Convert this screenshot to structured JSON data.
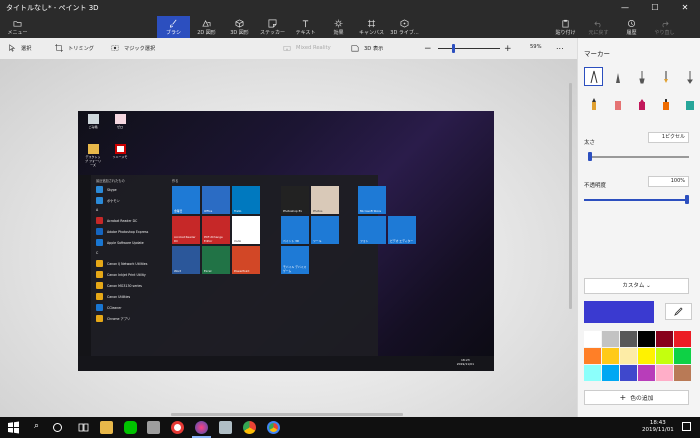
{
  "window": {
    "title": "タイトルなし* - ペイント 3D",
    "minimize": "—",
    "maximize": "☐",
    "close": "✕"
  },
  "toolbar": {
    "menu_label": "メニュー",
    "tools": [
      {
        "label": "ブラシ",
        "icon": "brush-icon",
        "active": true
      },
      {
        "label": "2D 図形",
        "icon": "2d-shapes-icon"
      },
      {
        "label": "3D 図形",
        "icon": "3d-shapes-icon"
      },
      {
        "label": "ステッカー",
        "icon": "stickers-icon"
      },
      {
        "label": "テキスト",
        "icon": "text-icon"
      },
      {
        "label": "効果",
        "icon": "effects-icon"
      },
      {
        "label": "キャンバス",
        "icon": "canvas-icon"
      },
      {
        "label": "3D ライブ...",
        "icon": "3d-library-icon"
      }
    ],
    "right_tools": [
      {
        "label": "貼り付け",
        "icon": "paste-icon"
      },
      {
        "label": "元に戻す",
        "icon": "undo-icon"
      },
      {
        "label": "履歴",
        "icon": "history-icon"
      },
      {
        "label": "やり直し",
        "icon": "redo-icon"
      }
    ]
  },
  "subbar": {
    "select": "選択",
    "crop": "トリミング",
    "magic_select": "マジック選択",
    "mixed_reality": "Mixed Reality",
    "view3d": "3D 表示",
    "zoom": "59%",
    "more": "..."
  },
  "screenshot": {
    "desktop_icons": [
      "ごみ箱",
      "ゼロ",
      "デスクトップ フォーリーズ",
      "ソニーメモ"
    ],
    "start_header": "最近追加されたもの",
    "start_apps": [
      "Skype",
      "ポケモン",
      "A",
      "Acrobat Reader DC",
      "Adobe Photoshop Express",
      "Apple Software Update",
      "C",
      "Canon IJ Network Utilities",
      "Canon Inkjet Print Utility",
      "Canon MG3130 series",
      "Canon Utilities",
      "CCleaner",
      "Chrome アプリ"
    ],
    "tiles_header": "作る",
    "tiles": [
      "金曜日",
      "Office",
      "Trello",
      "Acrobat Reader DC",
      "PDF-XChange Editor",
      "Xodo",
      "Word",
      "Excel",
      "PowerPoint",
      "Photoshop Ex",
      "Photos",
      "ペイント 3D",
      "ツール",
      "Microsoft Store",
      "フォト",
      "ビデオ エディター",
      "モバイル デバイス ゲーム"
    ],
    "clock": "18:23\n2019/11/01"
  },
  "panel": {
    "title": "マーカー",
    "thickness_label": "太さ",
    "thickness_value": "1ピクセル",
    "opacity_label": "不透明度",
    "opacity_value": "100%",
    "color_mode": "カスタム",
    "add_color": "色の追加",
    "main_color": "#3a3ad0",
    "palette": [
      "#ffffff",
      "#c3c3c3",
      "#585858",
      "#000000",
      "#88001b",
      "#ec1c24",
      "#ff7f27",
      "#ffca18",
      "#fdeca6",
      "#fff200",
      "#c4ff0e",
      "#0ed145",
      "#8cfffb",
      "#00a8f3",
      "#3f48cc",
      "#b83dba",
      "#ffaec8",
      "#b97a56"
    ]
  },
  "taskbar": {
    "search": "⌕",
    "clock_time": "18:43",
    "clock_date": "2019/11/01"
  }
}
